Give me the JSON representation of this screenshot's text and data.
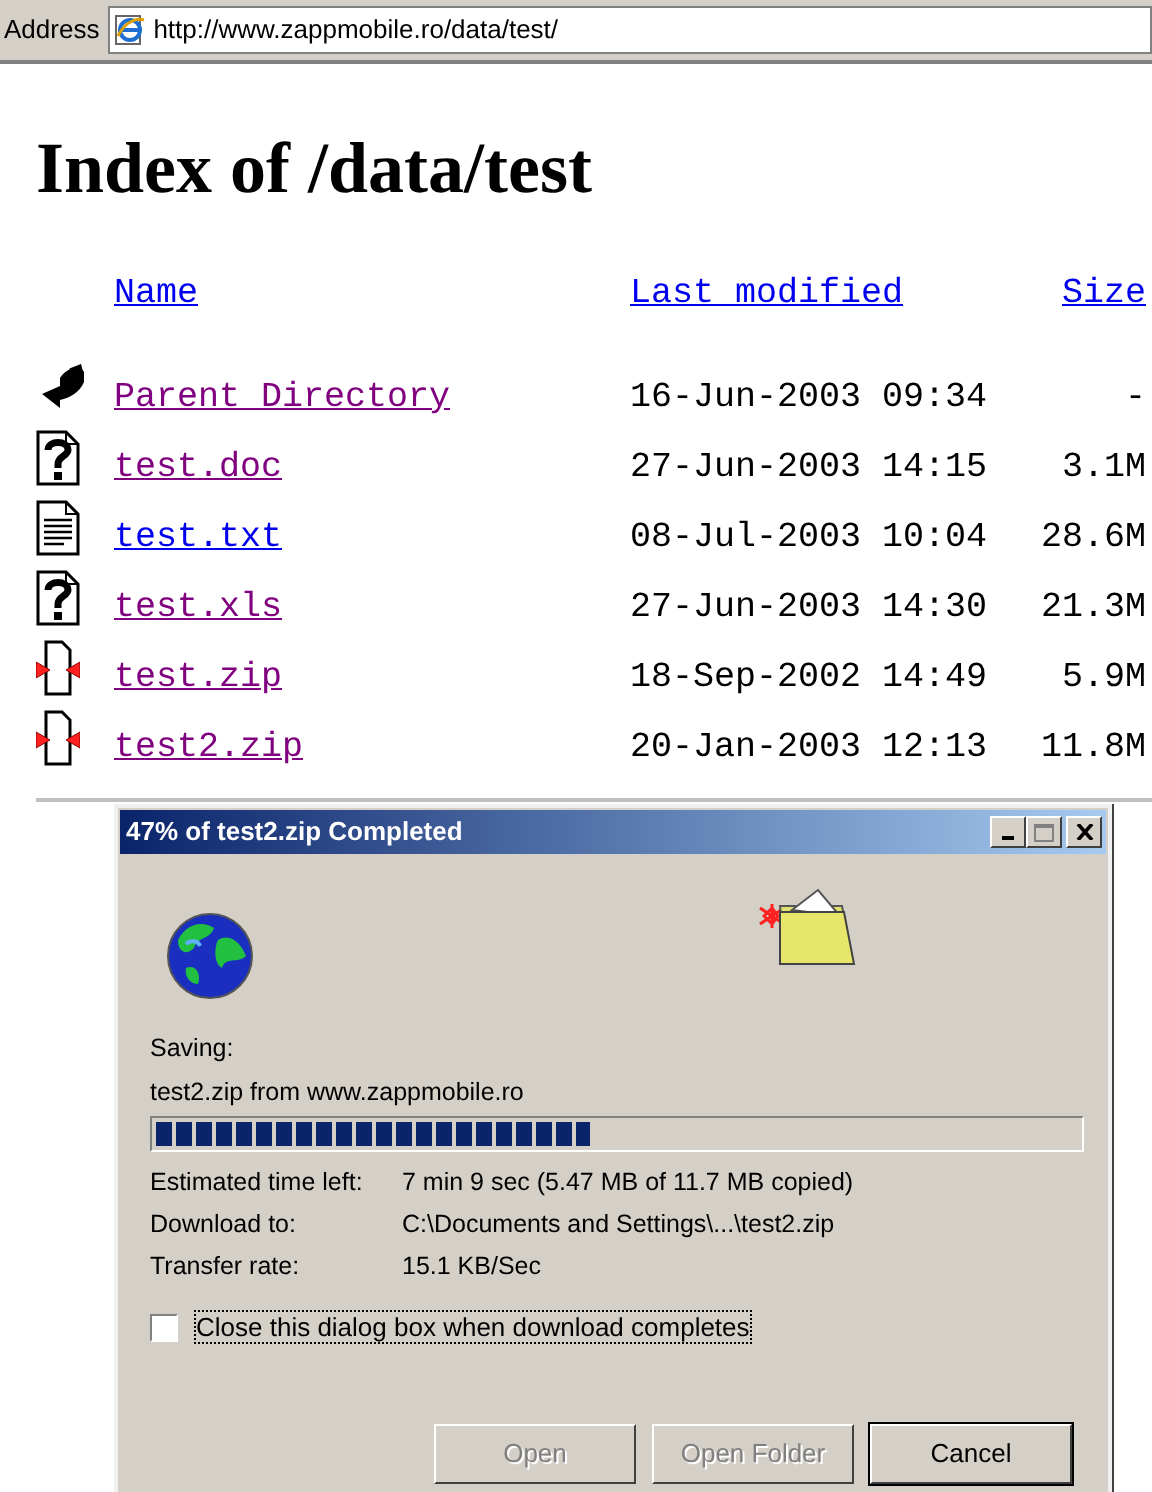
{
  "address_bar": {
    "label": "Address",
    "url": "http://www.zappmobile.ro/data/test/"
  },
  "heading": "Index of /data/test",
  "columns": [
    {
      "label": "Name"
    },
    {
      "label": "Last modified"
    },
    {
      "label": "Size"
    }
  ],
  "rows": [
    {
      "kind": "parent",
      "name": "Parent Directory",
      "visited": true,
      "modified": "16-Jun-2003 09:34",
      "size": "-"
    },
    {
      "kind": "unknown",
      "name": "test.doc",
      "visited": true,
      "modified": "27-Jun-2003 14:15",
      "size": "3.1M"
    },
    {
      "kind": "text",
      "name": "test.txt",
      "visited": false,
      "modified": "08-Jul-2003 10:04",
      "size": "28.6M"
    },
    {
      "kind": "unknown",
      "name": "test.xls",
      "visited": true,
      "modified": "27-Jun-2003 14:30",
      "size": "21.3M"
    },
    {
      "kind": "compressed",
      "name": "test.zip",
      "visited": true,
      "modified": "18-Sep-2002 14:49",
      "size": "5.9M"
    },
    {
      "kind": "compressed",
      "name": "test2.zip",
      "visited": true,
      "modified": "20-Jan-2003 12:13",
      "size": "11.8M"
    }
  ],
  "download_dialog": {
    "title": "47% of test2.zip Completed",
    "status_label": "Saving:",
    "source": "test2.zip from www.zappmobile.ro",
    "progress": {
      "level": 0.47
    },
    "details": [
      {
        "label": "Estimated time left:",
        "value": "7 min 9 sec (5.47 MB of 11.7 MB copied)"
      },
      {
        "label": "Download to:",
        "value": "C:\\Documents and Settings\\...\\test2.zip"
      },
      {
        "label": "Transfer rate:",
        "value": "15.1 KB/Sec"
      }
    ],
    "close_when_done": {
      "label": "Close this dialog box when download completes",
      "checked": false
    },
    "buttons": [
      {
        "label": "Open",
        "disabled": true
      },
      {
        "label": "Open Folder",
        "disabled": true
      },
      {
        "label": "Cancel",
        "disabled": false
      }
    ]
  }
}
